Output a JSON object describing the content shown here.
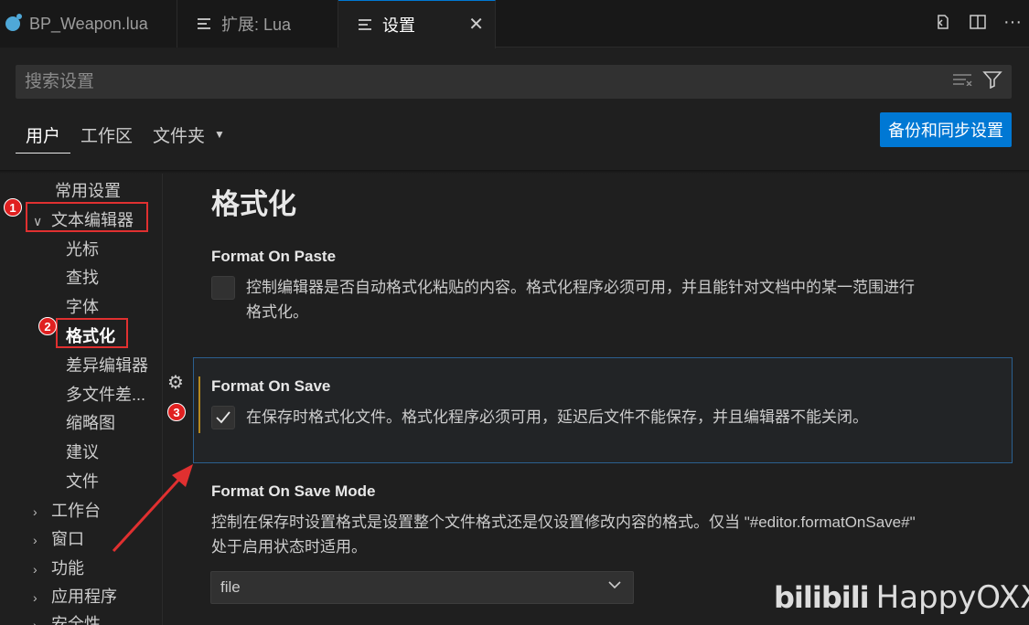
{
  "tabs": [
    {
      "label": "BP_Weapon.lua",
      "icon": "lua-file-icon"
    },
    {
      "label": "扩展: Lua",
      "icon": "extension-icon"
    },
    {
      "label": "设置",
      "icon": "settings-file-icon"
    }
  ],
  "search": {
    "placeholder": "搜索设置"
  },
  "scopes": [
    "用户",
    "工作区",
    "文件夹"
  ],
  "sync_button": "备份和同步设置",
  "toc": {
    "common": "常用设置",
    "text_editor": "文本编辑器",
    "children": [
      "光标",
      "查找",
      "字体",
      "格式化",
      "差异编辑器",
      "多文件差...",
      "缩略图",
      "建议",
      "文件"
    ],
    "collapsed": [
      "工作台",
      "窗口",
      "功能",
      "应用程序",
      "安全性"
    ]
  },
  "annotations": [
    "1",
    "2",
    "3"
  ],
  "section_title": "格式化",
  "settings": {
    "paste": {
      "title": "Format On Paste",
      "desc1": "控制编辑器是否自动格式化粘贴的内容。格式化程序必须可用，并且能针对文档中的某一范围进行",
      "desc2": "格式化。",
      "checked": false
    },
    "save": {
      "title": "Format On Save",
      "desc": "在保存时格式化文件。格式化程序必须可用，延迟后文件不能保存，并且编辑器不能关闭。",
      "checked": true
    },
    "save_mode": {
      "title": "Format On Save Mode",
      "desc1": "控制在保存时设置格式是设置整个文件格式还是仅设置修改内容的格式。仅当 \"#editor.formatOnSave#\"",
      "desc2": "处于启用状态时适用。",
      "value": "file"
    }
  },
  "watermark": {
    "logo": "bilibili",
    "name": "HappyOXX"
  },
  "colors": {
    "accent": "#0078d4",
    "annotation_red": "#e03030",
    "modified": "#b5891f"
  }
}
